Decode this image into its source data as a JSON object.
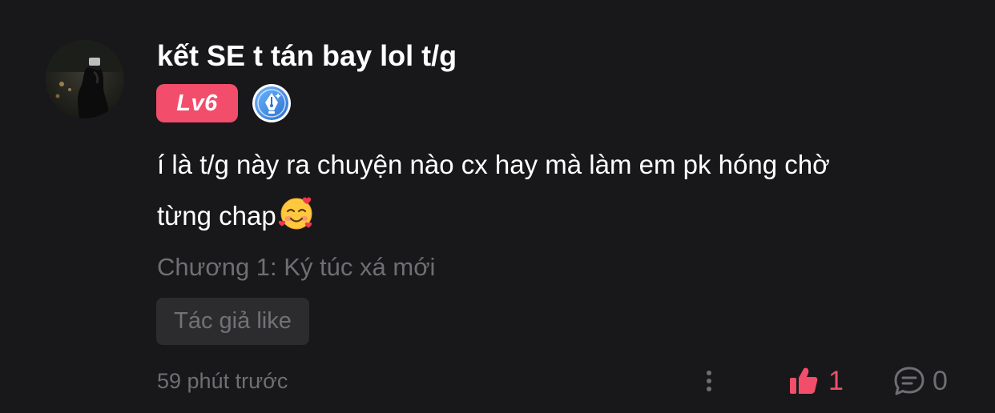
{
  "comment": {
    "username": "kết SE t tán bay lol t/g",
    "level": "Lv6",
    "content_line1": "í là t/g này ra chuyện nào cx hay mà làm em pk hóng chờ",
    "content_line2": "từng chap",
    "emoji": "smiling-face-with-hearts",
    "chapter": "Chương 1: Ký túc xá mới",
    "author_like": "Tác giả like",
    "timestamp": "59 phút trước",
    "like_count": "1",
    "reply_count": "0"
  },
  "colors": {
    "background": "#18181a",
    "accent": "#f24d6b",
    "muted_text": "#6f6f73",
    "tag_background": "#2c2c2e",
    "badge_blue": "#3b8ee8"
  },
  "icons": {
    "avatar": "avatar-photo",
    "writer_badge": "fountain-pen-badge-icon",
    "more": "more-vertical-icon",
    "like": "thumbs-up-icon",
    "reply": "comment-bubble-icon"
  }
}
